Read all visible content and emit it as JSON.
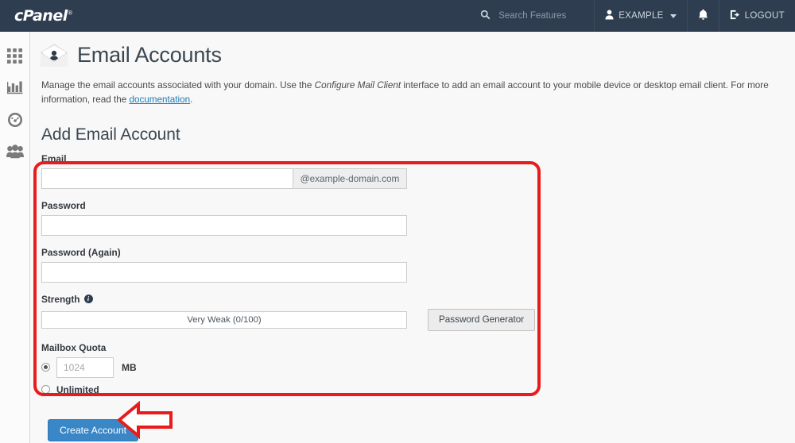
{
  "topbar": {
    "brand": "cPanel",
    "brand_tm": "®",
    "search": {
      "placeholder": "Search Features",
      "value": "",
      "icon": "search-icon"
    },
    "user": {
      "label": "EXAMPLE",
      "icon": "user-icon",
      "caret": "chevron-down-icon"
    },
    "notifications": {
      "icon": "bell-icon"
    },
    "logout": {
      "label": "LOGOUT",
      "icon": "logout-icon"
    }
  },
  "sidebar": {
    "items": [
      {
        "name": "apps-grid-icon",
        "title": "Home"
      },
      {
        "name": "bar-chart-icon",
        "title": "Statistics"
      },
      {
        "name": "gauge-icon",
        "title": "Server Information"
      },
      {
        "name": "users-icon",
        "title": "User Manager"
      }
    ]
  },
  "page": {
    "title": "Email Accounts",
    "title_icon": "email-account-icon",
    "description_part1": "Manage the email accounts associated with your domain. Use the ",
    "description_italic": "Configure Mail Client",
    "description_part2": " interface to add an email account to your mobile device or desktop email client. For more information, read the ",
    "description_link": "documentation",
    "description_part3": "."
  },
  "form": {
    "heading": "Add Email Account",
    "email": {
      "label": "Email",
      "value": "",
      "placeholder": "",
      "domain_addon": "@example-domain.com"
    },
    "password": {
      "label": "Password",
      "value": "",
      "placeholder": ""
    },
    "password_again": {
      "label": "Password (Again)",
      "value": "",
      "placeholder": ""
    },
    "strength": {
      "label": "Strength",
      "info_icon": "info-icon",
      "meter_text": "Very Weak (0/100)",
      "score": 0,
      "max_score": 100,
      "generator_button": "Password Generator"
    },
    "quota": {
      "label": "Mailbox Quota",
      "fixed_selected": true,
      "value": "",
      "placeholder": "1024",
      "unit": "MB",
      "unlimited_label": "Unlimited",
      "unlimited_selected": false
    },
    "submit_button": "Create Account"
  },
  "annotations": {
    "highlight_color": "#e81c1c",
    "arrow_target": "Create Account"
  }
}
